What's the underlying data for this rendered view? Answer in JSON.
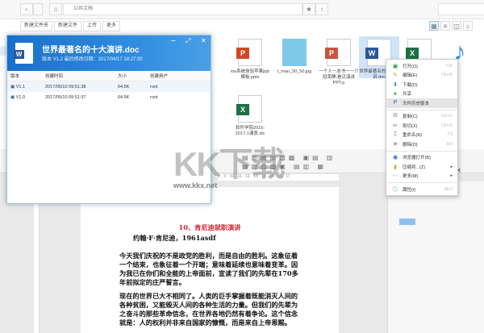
{
  "file_manager": {
    "breadcrumb": "公共文档",
    "toolbar": [
      "新建文件夹",
      "新建文件",
      "上传",
      "更多"
    ],
    "files": [
      {
        "name": "ios系统体验苹果ppt模板.pptx",
        "type": "ppt"
      },
      {
        "name": "t_man_50_50.jpg",
        "type": "jpg"
      },
      {
        "name": "一个人一本书一一介绍荣静,看见演讲PPT.p",
        "type": "ppt"
      },
      {
        "name": "世界最著名的十大演讲.doc",
        "type": "doc"
      },
      {
        "name": "",
        "type": "xls"
      },
      {
        "name": "",
        "type": "music"
      },
      {
        "name": "软件学院2016-2017-1课表.xls",
        "type": "xls"
      }
    ]
  },
  "version_dialog": {
    "title": "世界最著名的十大演讲.doc",
    "subtitle": "版本 V1.2 最后修改日期：2017/04/17 18:27:30",
    "columns": [
      "版本",
      "创建时间",
      "大小",
      "创建用户"
    ],
    "rows": [
      [
        "V1.1",
        "2017/05/10 09:51:38",
        "64.5K",
        "root"
      ],
      [
        "V1.0",
        "2017/05/10 09:51:37",
        "64.5K",
        "root"
      ]
    ]
  },
  "context_menu": [
    {
      "label": "打开(O)",
      "shortcut": "Ctrl",
      "icon": "open-icon"
    },
    {
      "label": "编辑(E)",
      "shortcut": "Ctrl+E",
      "icon": "edit-icon"
    },
    {
      "label": "下载(D)",
      "shortcut": "",
      "icon": "download-icon"
    },
    {
      "label": "共享",
      "shortcut": "",
      "icon": "share-icon"
    },
    {
      "label": "文件历史版本",
      "shortcut": "",
      "icon": "history-icon"
    },
    {
      "label": "复制(C)",
      "shortcut": "Ctrl+C",
      "icon": "copy-icon"
    },
    {
      "label": "剪切(X)",
      "shortcut": "Ctrl+X",
      "icon": "cut-icon"
    },
    {
      "label": "重命名(R)",
      "shortcut": "F2",
      "icon": "rename-icon"
    },
    {
      "label": "删除(D)",
      "shortcut": "Del",
      "icon": "delete-icon"
    },
    {
      "label": "浏览器打开(B)",
      "shortcut": "",
      "icon": "browser-icon"
    },
    {
      "label": "压缩到...(Z)",
      "shortcut": "",
      "icon": "zip-icon"
    },
    {
      "label": "更多(M)",
      "shortcut": "",
      "icon": "more-icon"
    },
    {
      "label": "属性(I)",
      "shortcut": "Alt+I",
      "icon": "info-icon"
    }
  ],
  "document": {
    "heading": "10、肯尼迪就职演讲",
    "author": "约翰·F·肯尼迪，1961asdf",
    "paragraphs": [
      "今天我们庆祝的不是政党的胜利，而是自由的胜利。这象征着一个结束，也象征着一个开端；意味着延续也意味着变革。因为我已在你们和全能的上帝面前，宣读了我们的先辈在170多年前拟定的庄严誓言。",
      "现在的世界已大不相同了。人类的巨手掌握着既能消灭人间的各种贫困，又能毁灭人间的各种生活的力量。但我们的先辈为之奋斗的那些革命信念，在世界各地仍然有着争论。这个信念就是：人的权利并非来自国家的慷慨，而是来自上帝恩赐。"
    ],
    "ruler": "8 · 9 · 10 · 11 · 12 · 13 · 14 · 15 · 16 · 17"
  },
  "watermark": {
    "logo": "KK下载",
    "url": "www.kkx.net"
  },
  "colors": {
    "accent": "#1a6fc9",
    "heading": "#d0202a"
  }
}
